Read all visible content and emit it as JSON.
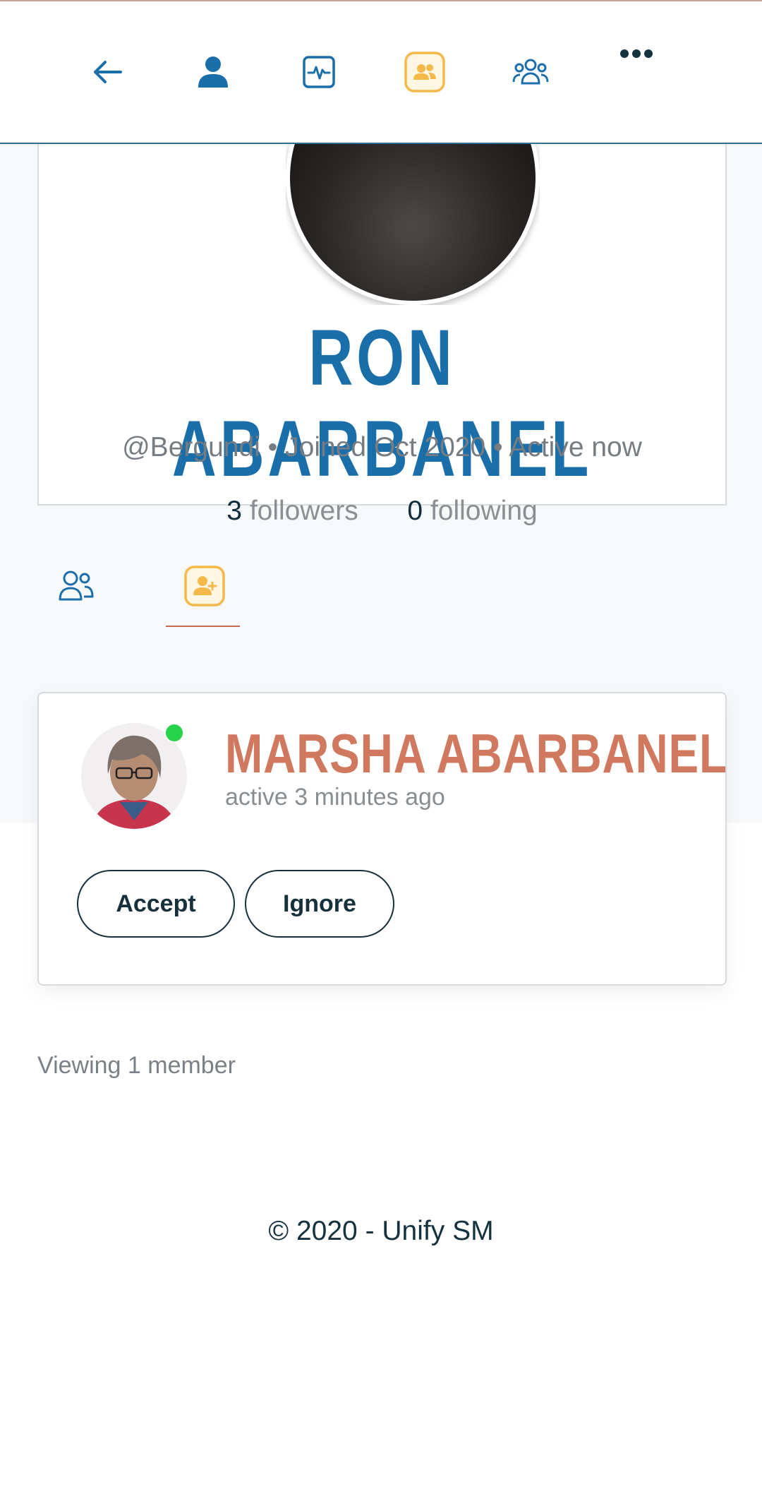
{
  "nav": {
    "items": [
      {
        "name": "back",
        "icon": "arrow-left-icon"
      },
      {
        "name": "profile",
        "icon": "person-icon"
      },
      {
        "name": "activity",
        "icon": "activity-icon"
      },
      {
        "name": "connections",
        "icon": "connections-icon",
        "active": true
      },
      {
        "name": "groups",
        "icon": "groups-icon"
      },
      {
        "name": "more",
        "icon": "more-dots-icon"
      }
    ]
  },
  "profile": {
    "name": "RON ABARBANEL",
    "meta": "@Bergundi • Joined Oct 2020 • Active now",
    "followers_count": "3",
    "followers_label": "followers",
    "following_count": "0",
    "following_label": "following"
  },
  "tabs": [
    {
      "name": "friends",
      "icon": "people-icon"
    },
    {
      "name": "requests",
      "icon": "friend-requests-icon",
      "active": true
    }
  ],
  "member": {
    "name": "MARSHA ABARBANEL",
    "activity": "active 3 minutes ago",
    "accept_label": "Accept",
    "ignore_label": "Ignore"
  },
  "viewing_text": "Viewing 1 member",
  "footer_text": "© 2020 - Unify SM",
  "colors": {
    "primary": "#1a6faa",
    "accent": "#f5b94a",
    "member_name": "#d0795f",
    "online": "#27d34b",
    "dark": "#16303c"
  }
}
